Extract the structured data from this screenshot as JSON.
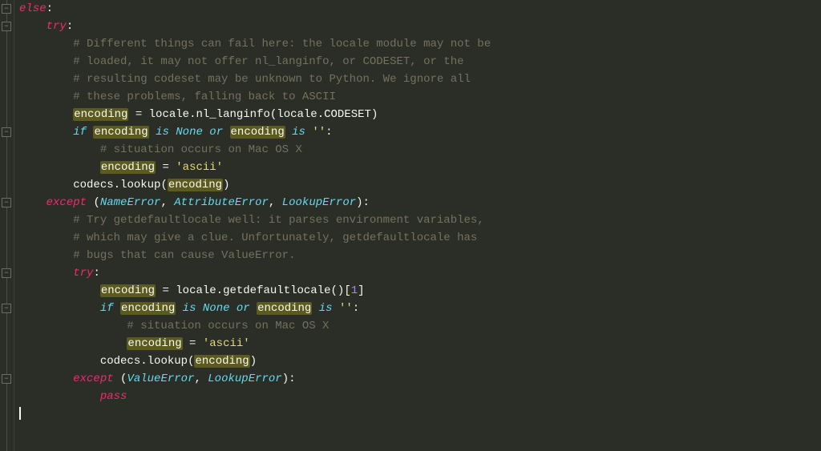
{
  "code": {
    "lines": [
      {
        "indent": 0,
        "tokens": [
          [
            "kw",
            "else"
          ],
          [
            "punct",
            ":"
          ]
        ]
      },
      {
        "indent": 1,
        "tokens": [
          [
            "kw",
            "try"
          ],
          [
            "punct",
            ":"
          ]
        ]
      },
      {
        "indent": 2,
        "tokens": [
          [
            "cmt",
            "# Different things can fail here: the locale module may not be"
          ]
        ]
      },
      {
        "indent": 2,
        "tokens": [
          [
            "cmt",
            "# loaded, it may not offer nl_langinfo, or CODESET, or the"
          ]
        ]
      },
      {
        "indent": 2,
        "tokens": [
          [
            "cmt",
            "# resulting codeset may be unknown to Python. We ignore all"
          ]
        ]
      },
      {
        "indent": 2,
        "tokens": [
          [
            "cmt",
            "# these problems, falling back to ASCII"
          ]
        ]
      },
      {
        "indent": 2,
        "tokens": [
          [
            "hl",
            "encoding"
          ],
          [
            "ident",
            " "
          ],
          [
            "punct",
            "="
          ],
          [
            "ident",
            " locale"
          ],
          [
            "punct",
            "."
          ],
          [
            "func",
            "nl_langinfo"
          ],
          [
            "punct",
            "("
          ],
          [
            "ident",
            "locale"
          ],
          [
            "punct",
            "."
          ],
          [
            "ident",
            "CODESET"
          ],
          [
            "punct",
            ")"
          ]
        ]
      },
      {
        "indent": 2,
        "tokens": [
          [
            "kw2",
            "if"
          ],
          [
            "ident",
            " "
          ],
          [
            "hl",
            "encoding"
          ],
          [
            "ident",
            " "
          ],
          [
            "kw2",
            "is"
          ],
          [
            "ident",
            " "
          ],
          [
            "none",
            "None"
          ],
          [
            "ident",
            " "
          ],
          [
            "kw2",
            "or"
          ],
          [
            "ident",
            " "
          ],
          [
            "hl",
            "encoding"
          ],
          [
            "ident",
            " "
          ],
          [
            "kw2",
            "is"
          ],
          [
            "ident",
            " "
          ],
          [
            "str",
            "''"
          ],
          [
            "punct",
            ":"
          ]
        ]
      },
      {
        "indent": 3,
        "tokens": [
          [
            "cmt",
            "# situation occurs on Mac OS X"
          ]
        ]
      },
      {
        "indent": 3,
        "tokens": [
          [
            "hl",
            "encoding"
          ],
          [
            "ident",
            " "
          ],
          [
            "punct",
            "="
          ],
          [
            "ident",
            " "
          ],
          [
            "str",
            "'ascii'"
          ]
        ]
      },
      {
        "indent": 2,
        "tokens": [
          [
            "ident",
            "codecs"
          ],
          [
            "punct",
            "."
          ],
          [
            "func",
            "lookup"
          ],
          [
            "punct",
            "("
          ],
          [
            "hl",
            "encoding"
          ],
          [
            "punct",
            ")"
          ]
        ]
      },
      {
        "indent": 1,
        "tokens": [
          [
            "kw",
            "except"
          ],
          [
            "ident",
            " "
          ],
          [
            "punct",
            "("
          ],
          [
            "exc",
            "NameError"
          ],
          [
            "punct",
            ", "
          ],
          [
            "exc",
            "AttributeError"
          ],
          [
            "punct",
            ", "
          ],
          [
            "exc",
            "LookupError"
          ],
          [
            "punct",
            ")"
          ],
          [
            "punct",
            ":"
          ]
        ]
      },
      {
        "indent": 2,
        "tokens": [
          [
            "cmt",
            "# Try getdefaultlocale well: it parses environment variables,"
          ]
        ]
      },
      {
        "indent": 2,
        "tokens": [
          [
            "cmt",
            "# which may give a clue. Unfortunately, getdefaultlocale has"
          ]
        ]
      },
      {
        "indent": 2,
        "tokens": [
          [
            "cmt",
            "# bugs that can cause ValueError."
          ]
        ]
      },
      {
        "indent": 2,
        "tokens": [
          [
            "kw",
            "try"
          ],
          [
            "punct",
            ":"
          ]
        ]
      },
      {
        "indent": 3,
        "tokens": [
          [
            "hl",
            "encoding"
          ],
          [
            "ident",
            " "
          ],
          [
            "punct",
            "="
          ],
          [
            "ident",
            " locale"
          ],
          [
            "punct",
            "."
          ],
          [
            "func",
            "getdefaultlocale"
          ],
          [
            "punct",
            "()"
          ],
          [
            "punct",
            "["
          ],
          [
            "num",
            "1"
          ],
          [
            "punct",
            "]"
          ]
        ]
      },
      {
        "indent": 3,
        "tokens": [
          [
            "kw2",
            "if"
          ],
          [
            "ident",
            " "
          ],
          [
            "hl",
            "encoding"
          ],
          [
            "ident",
            " "
          ],
          [
            "kw2",
            "is"
          ],
          [
            "ident",
            " "
          ],
          [
            "none",
            "None"
          ],
          [
            "ident",
            " "
          ],
          [
            "kw2",
            "or"
          ],
          [
            "ident",
            " "
          ],
          [
            "hl",
            "encoding"
          ],
          [
            "ident",
            " "
          ],
          [
            "kw2",
            "is"
          ],
          [
            "ident",
            " "
          ],
          [
            "str",
            "''"
          ],
          [
            "punct",
            ":"
          ]
        ]
      },
      {
        "indent": 4,
        "tokens": [
          [
            "cmt",
            "# situation occurs on Mac OS X"
          ]
        ]
      },
      {
        "indent": 4,
        "tokens": [
          [
            "hl",
            "encoding"
          ],
          [
            "ident",
            " "
          ],
          [
            "punct",
            "="
          ],
          [
            "ident",
            " "
          ],
          [
            "str",
            "'ascii'"
          ]
        ]
      },
      {
        "indent": 3,
        "tokens": [
          [
            "ident",
            "codecs"
          ],
          [
            "punct",
            "."
          ],
          [
            "func",
            "lookup"
          ],
          [
            "punct",
            "("
          ],
          [
            "hl",
            "encoding"
          ],
          [
            "punct",
            ")"
          ]
        ]
      },
      {
        "indent": 2,
        "tokens": [
          [
            "kw",
            "except"
          ],
          [
            "ident",
            " "
          ],
          [
            "punct",
            "("
          ],
          [
            "exc",
            "ValueError"
          ],
          [
            "punct",
            ", "
          ],
          [
            "exc",
            "LookupError"
          ],
          [
            "punct",
            ")"
          ],
          [
            "punct",
            ":"
          ]
        ]
      },
      {
        "indent": 3,
        "tokens": [
          [
            "kw",
            "pass"
          ]
        ]
      }
    ],
    "fold_positions": [
      0,
      1,
      7,
      11,
      15,
      17,
      21
    ],
    "indent_width": 4,
    "highlight_word": "encoding",
    "cursor_line": 23
  },
  "colors": {
    "background": "#2a2e27",
    "keyword_pink": "#f92672",
    "keyword_cyan": "#66d9ef",
    "string": "#e6db74",
    "number": "#ae81ff",
    "comment": "#75715e",
    "highlight_bg": "#5b5b1f",
    "foreground": "#f8f8f2"
  }
}
